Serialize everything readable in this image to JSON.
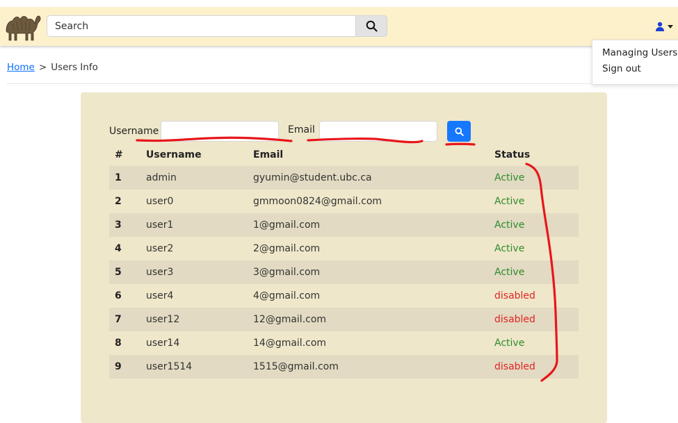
{
  "header": {
    "logo_icon": "camel-logo-icon",
    "search_placeholder": "Search",
    "search_icon": "search-icon",
    "user_icon": "user-icon"
  },
  "user_menu": {
    "items": [
      {
        "label": "Managing Users"
      },
      {
        "label": "Sign out"
      }
    ]
  },
  "breadcrumb": {
    "home": "Home",
    "separator": ">",
    "current": "Users Info"
  },
  "filters": {
    "username_label": "Username",
    "username_value": "",
    "email_label": "Email",
    "email_value": "",
    "search_icon": "search-icon",
    "button_color": "#1677ff"
  },
  "table": {
    "headers": [
      "#",
      "Username",
      "Email",
      "Status"
    ],
    "rows": [
      {
        "num": "1",
        "username": "admin",
        "email": "gyumin@student.ubc.ca",
        "status": "Active"
      },
      {
        "num": "2",
        "username": "user0",
        "email": "gmmoon0824@gmail.com",
        "status": "Active"
      },
      {
        "num": "3",
        "username": "user1",
        "email": "1@gmail.com",
        "status": "Active"
      },
      {
        "num": "4",
        "username": "user2",
        "email": "2@gmail.com",
        "status": "Active"
      },
      {
        "num": "5",
        "username": "user3",
        "email": "3@gmail.com",
        "status": "Active"
      },
      {
        "num": "6",
        "username": "user4",
        "email": "4@gmail.com",
        "status": "disabled"
      },
      {
        "num": "7",
        "username": "user12",
        "email": "12@gmail.com",
        "status": "disabled"
      },
      {
        "num": "8",
        "username": "user14",
        "email": "14@gmail.com",
        "status": "Active"
      },
      {
        "num": "9",
        "username": "user1514",
        "email": "1515@gmail.com",
        "status": "disabled"
      }
    ]
  },
  "colors": {
    "navbar": "#fdf1cc",
    "panel": "#efe7ca",
    "stripe": "#e2dac2",
    "active": "#2e8b2e",
    "disabled": "#e02424",
    "annotation": "#e8161b"
  }
}
